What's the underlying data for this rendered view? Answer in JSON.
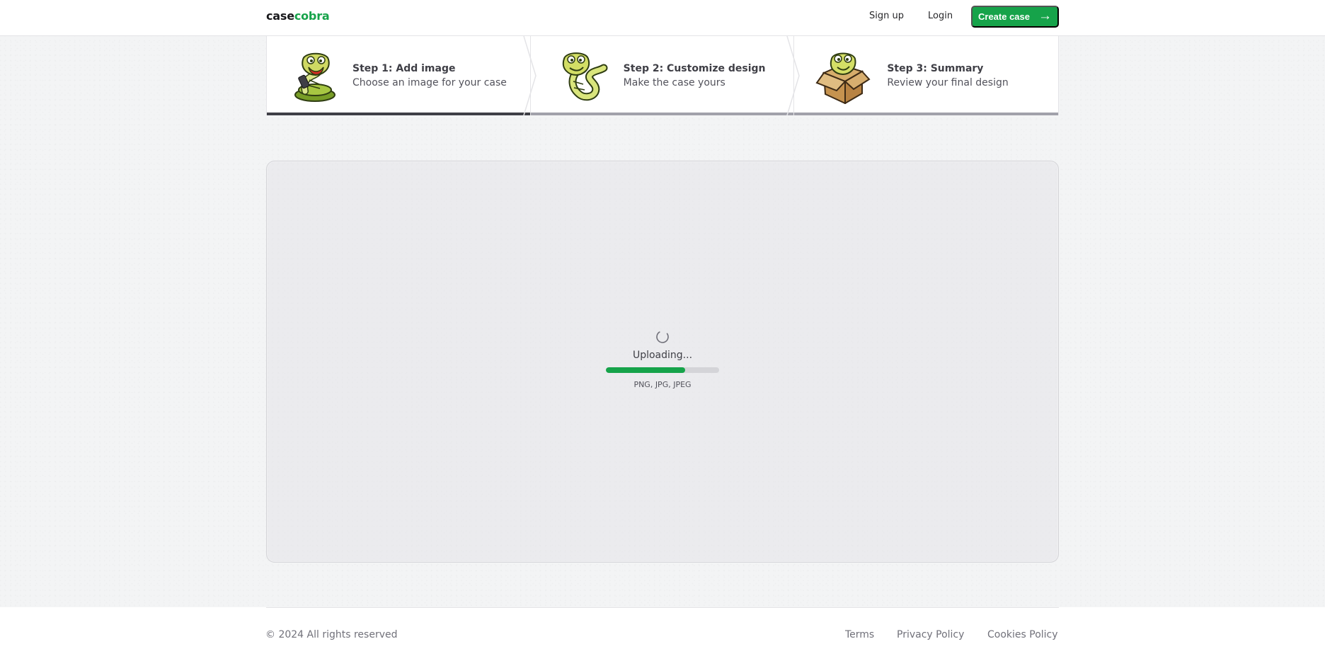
{
  "brand": {
    "name_prefix": "case",
    "name_accent": "cobra",
    "accent_color": "#16a34a"
  },
  "navbar": {
    "signup_label": "Sign up",
    "login_label": "Login",
    "create_label": "Create case",
    "create_icon": "arrow-right-icon"
  },
  "steps": [
    {
      "title": "Step 1: Add image",
      "description": "Choose an image for your case",
      "icon": "cobra-phone-icon",
      "state": "current"
    },
    {
      "title": "Step 2: Customize design",
      "description": "Make the case yours",
      "icon": "cobra-wave-icon",
      "state": "upcoming"
    },
    {
      "title": "Step 3: Summary",
      "description": "Review your final design",
      "icon": "cobra-box-icon",
      "state": "upcoming"
    }
  ],
  "upload": {
    "status_icon": "loading-spinner-icon",
    "status_text": "Uploading...",
    "progress_percent": 70,
    "accepted_types": "PNG, JPG, JPEG"
  },
  "footer": {
    "copyright": "© 2024 All rights reserved",
    "links": [
      "Terms",
      "Privacy Policy",
      "Cookies Policy"
    ]
  }
}
